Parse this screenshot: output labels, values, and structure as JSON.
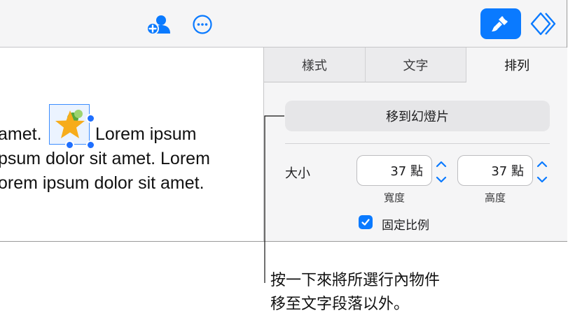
{
  "toolbar": {
    "collaborate_icon": "add-person-icon",
    "more_icon": "ellipsis-circle-icon",
    "format_icon": "paintbrush-icon",
    "animate_icon": "diamond-icon",
    "accent_color": "#0a7aff"
  },
  "document": {
    "line1_before": "amet.",
    "line1_after": "Lorem ipsum",
    "line2": "psum dolor sit amet. Lorem",
    "line3": "orem ipsum dolor sit amet.",
    "selected_object": "star-with-circles-icon"
  },
  "sidebar": {
    "tabs": [
      {
        "label": "樣式",
        "active": false
      },
      {
        "label": "文字",
        "active": false
      },
      {
        "label": "排列",
        "active": true
      }
    ],
    "move_button_label": "移到幻燈片",
    "size_label": "大小",
    "width_value": "37 點",
    "height_value": "37 點",
    "width_caption": "寬度",
    "height_caption": "高度",
    "constrain_label": "固定比例",
    "constrain_checked": true
  },
  "callout": {
    "line1": "按一下來將所選行內物件",
    "line2": "移至文字段落以外。"
  }
}
